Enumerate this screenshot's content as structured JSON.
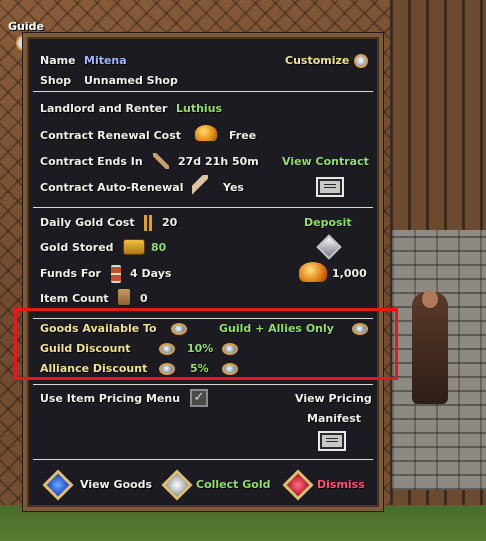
{
  "guide": {
    "label": "Guide"
  },
  "header": {
    "name_label": "Name",
    "name_value": "Mitena",
    "customize_label": "Customize",
    "shop_label": "Shop",
    "shop_value": "Unnamed Shop"
  },
  "contract": {
    "landlord_label": "Landlord and Renter",
    "landlord_value": "Luthius",
    "renewal_cost_label": "Contract Renewal Cost",
    "renewal_cost_value": "Free",
    "ends_label": "Contract Ends In",
    "ends_value": "27d 21h 50m",
    "view_contract_label": "View Contract",
    "auto_renewal_label": "Contract Auto-Renewal",
    "auto_renewal_value": "Yes"
  },
  "finances": {
    "daily_gold_label": "Daily Gold Cost",
    "daily_gold_value": "20",
    "deposit_label": "Deposit",
    "gold_stored_label": "Gold Stored",
    "gold_stored_value": "80",
    "funds_for_label": "Funds For",
    "funds_for_value": "4 Days",
    "bank_amount": "1,000",
    "item_count_label": "Item Count",
    "item_count_value": "0"
  },
  "goods": {
    "available_label": "Goods Available To",
    "available_value": "Guild + Allies Only",
    "guild_discount_label": "Guild Discount",
    "guild_discount_value": "10%",
    "alliance_discount_label": "Alliance Discount",
    "alliance_discount_value": "5%"
  },
  "pricing": {
    "use_menu_label": "Use Item Pricing Menu",
    "use_menu_checked": true,
    "view_pricing_line1": "View Pricing",
    "view_pricing_line2": "Manifest"
  },
  "footer": {
    "view_goods_label": "View Goods",
    "collect_gold_label": "Collect Gold",
    "dismiss_label": "Dismiss"
  },
  "colors": {
    "highlight": "#e81818",
    "green_value": "#8fe06a",
    "blue_name": "#9fb6ff",
    "dismiss": "#ff5070"
  }
}
